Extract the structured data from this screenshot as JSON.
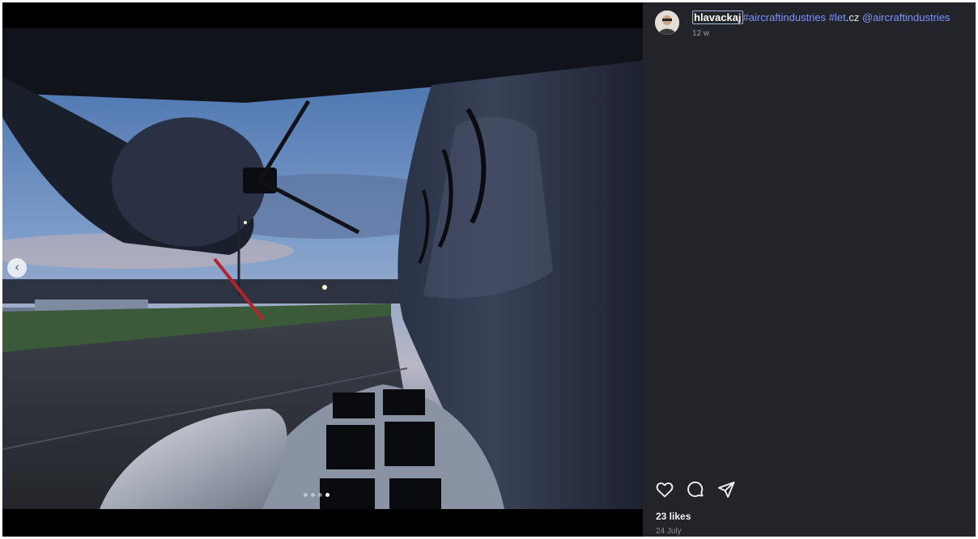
{
  "post": {
    "username": "hlavackaj",
    "caption_parts": [
      {
        "text": "#aircraftindustries",
        "kind": "tag"
      },
      {
        "text": " ",
        "kind": "space"
      },
      {
        "text": "#let",
        "kind": "tag"
      },
      {
        "text": ".cz ",
        "kind": "plain"
      },
      {
        "text": "@aircraftindustries",
        "kind": "tag"
      }
    ],
    "time_ago": "12 w",
    "likes": "23 likes",
    "date": "24 July"
  },
  "carousel": {
    "prev_icon": "‹",
    "dot_count": 4,
    "active_dot": 3
  },
  "icons": {
    "like": "heart-icon",
    "comment": "comment-icon",
    "share": "share-icon",
    "prev": "chevron-left-icon"
  },
  "colors": {
    "panel_bg": "#23242a",
    "link": "#7d94ff",
    "text": "#e8e8ea"
  }
}
